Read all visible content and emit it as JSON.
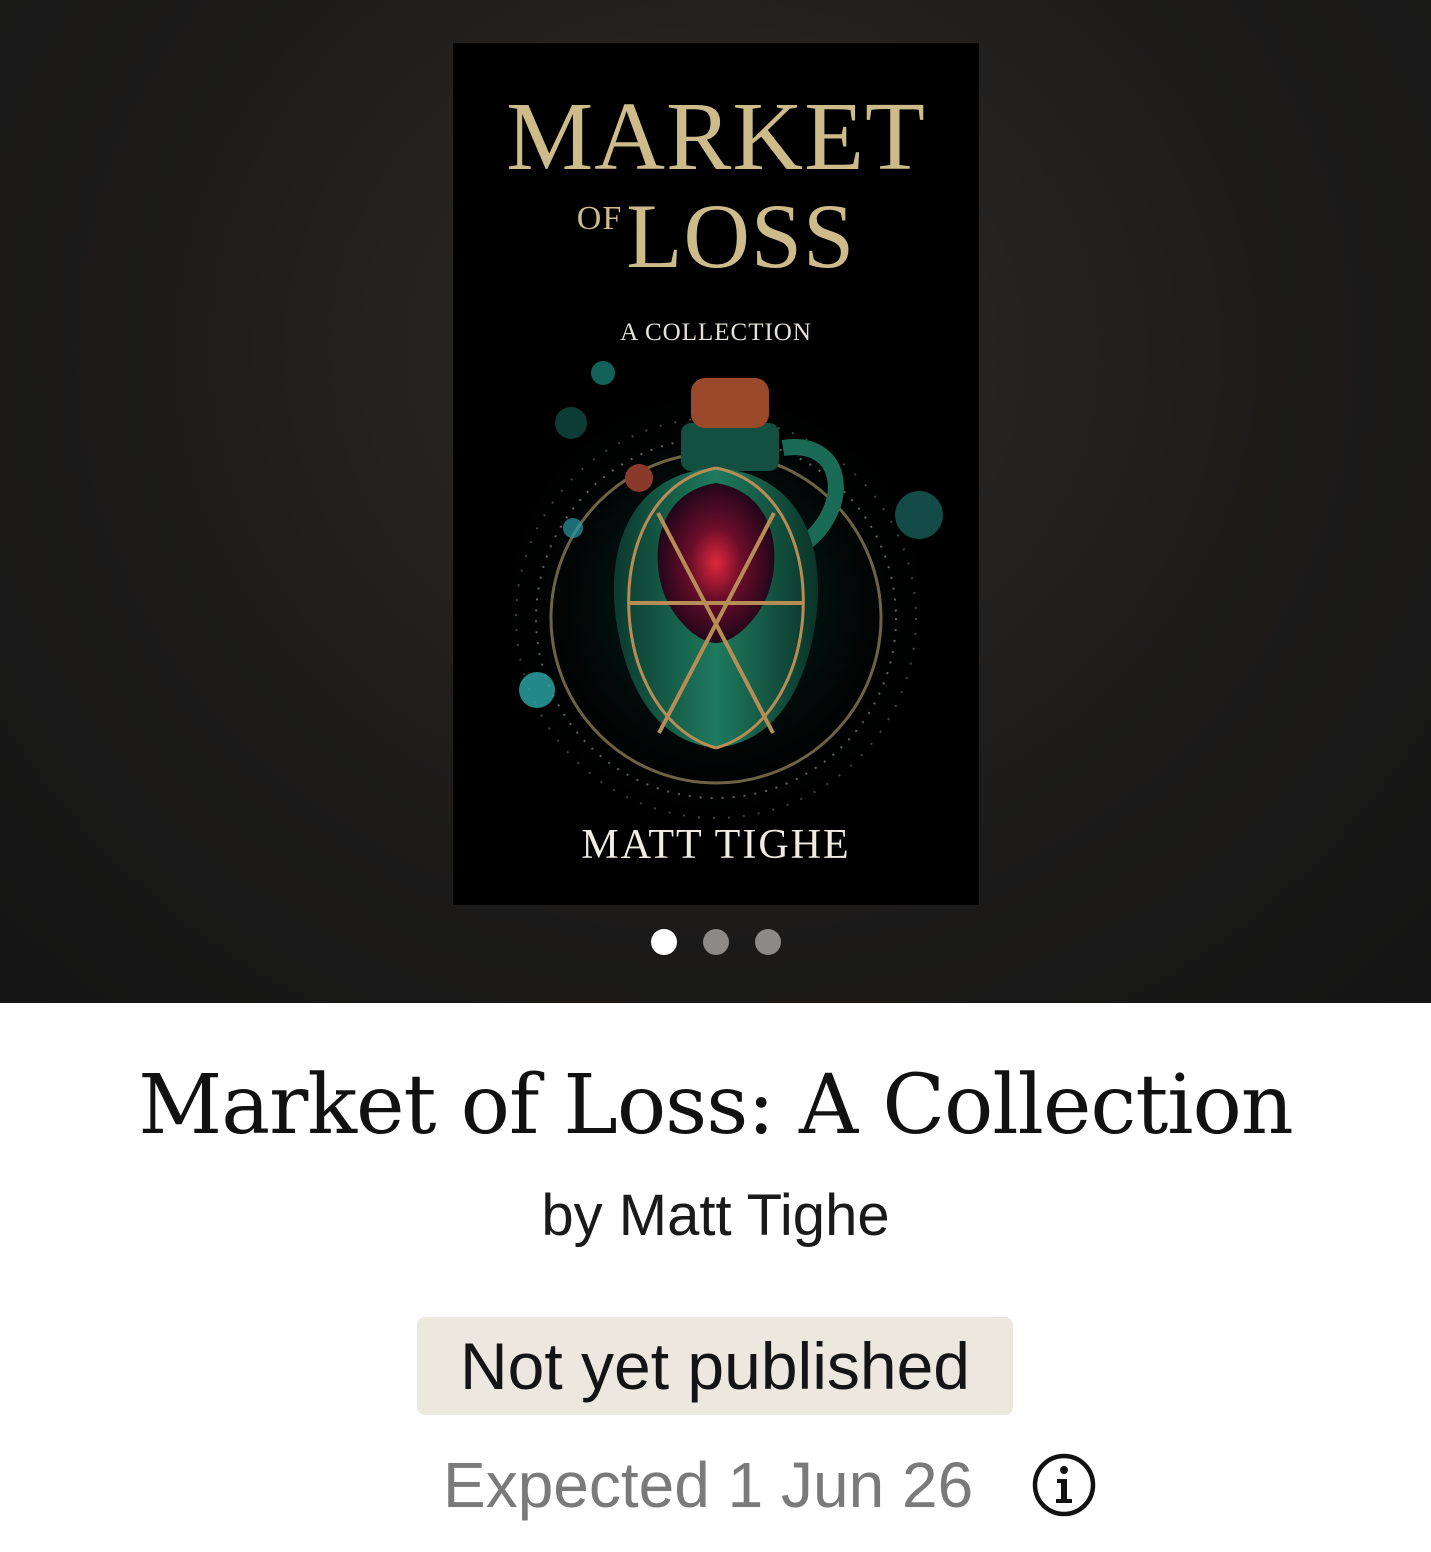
{
  "carousel": {
    "cover": {
      "title_line1": "MARKET",
      "title_of": "OF",
      "title_line2": "LOSS",
      "subtitle": "A COLLECTION",
      "author": "MATT TIGHE"
    },
    "page_count": 3,
    "active_page": 1
  },
  "book": {
    "title": "Market of Loss: A Collection",
    "author_line": "by Matt Tighe",
    "status_badge": "Not yet published",
    "expected": "Expected 1 Jun 26"
  },
  "icons": {
    "info": "info-icon"
  },
  "colors": {
    "badge_bg": "#ece8df",
    "cover_gold": "#cdbb8a",
    "active_dot": "#ffffff",
    "inactive_dot": "#8c8a88"
  }
}
